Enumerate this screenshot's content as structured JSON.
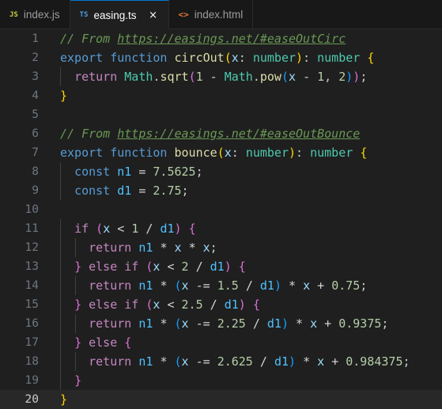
{
  "tabs": [
    {
      "icon": "JS",
      "label": "index.js",
      "active": false
    },
    {
      "icon": "TS",
      "label": "easing.ts",
      "active": true,
      "close": "×"
    },
    {
      "icon": "<>",
      "label": "index.html",
      "active": false
    }
  ],
  "colors": {
    "editor_bg": "#1f1f1f",
    "tabbar_bg": "#181818",
    "current_line_bg": "#282828",
    "comment": "#6a9955",
    "keyword": "#569cd6",
    "function": "#dcdcaa",
    "param": "#9cdcfe",
    "type": "#4ec9b0",
    "number": "#b5cea8"
  },
  "editor": {
    "current_line": 20,
    "lines": [
      {
        "n": "1",
        "tokens": [
          [
            "c-comment",
            "// From "
          ],
          [
            "c-comment c-link",
            "https://easings.net/#easeOutCirc"
          ]
        ]
      },
      {
        "n": "2",
        "tokens": [
          [
            "c-kw",
            "export"
          ],
          [
            "c-pl",
            " "
          ],
          [
            "c-kw",
            "function"
          ],
          [
            "c-pl",
            " "
          ],
          [
            "c-fn",
            "circOut"
          ],
          [
            "c-brace",
            "("
          ],
          [
            "c-param",
            "x"
          ],
          [
            "c-pl",
            ": "
          ],
          [
            "c-type",
            "number"
          ],
          [
            "c-brace",
            ")"
          ],
          [
            "c-pl",
            ": "
          ],
          [
            "c-type",
            "number"
          ],
          [
            "c-pl",
            " "
          ],
          [
            "c-brace",
            "{"
          ]
        ]
      },
      {
        "n": "3",
        "tokens": [
          [
            "c-pl",
            "  "
          ],
          [
            "c-ctrl",
            "return"
          ],
          [
            "c-pl",
            " "
          ],
          [
            "c-type",
            "Math"
          ],
          [
            "c-pl",
            "."
          ],
          [
            "c-fn",
            "sqrt"
          ],
          [
            "c-brace2",
            "("
          ],
          [
            "c-num",
            "1"
          ],
          [
            "c-pl",
            " "
          ],
          [
            "c-op",
            "-"
          ],
          [
            "c-pl",
            " "
          ],
          [
            "c-type",
            "Math"
          ],
          [
            "c-pl",
            "."
          ],
          [
            "c-fn",
            "pow"
          ],
          [
            "c-brace3",
            "("
          ],
          [
            "c-param",
            "x"
          ],
          [
            "c-pl",
            " "
          ],
          [
            "c-op",
            "-"
          ],
          [
            "c-pl",
            " "
          ],
          [
            "c-num",
            "1"
          ],
          [
            "c-pl",
            ", "
          ],
          [
            "c-num",
            "2"
          ],
          [
            "c-brace3",
            ")"
          ],
          [
            "c-brace2",
            ")"
          ],
          [
            "c-pl",
            ";"
          ]
        ]
      },
      {
        "n": "4",
        "tokens": [
          [
            "c-brace",
            "}"
          ]
        ]
      },
      {
        "n": "5",
        "tokens": []
      },
      {
        "n": "6",
        "tokens": [
          [
            "c-comment",
            "// From "
          ],
          [
            "c-comment c-link",
            "https://easings.net/#easeOutBounce"
          ]
        ]
      },
      {
        "n": "7",
        "tokens": [
          [
            "c-kw",
            "export"
          ],
          [
            "c-pl",
            " "
          ],
          [
            "c-kw",
            "function"
          ],
          [
            "c-pl",
            " "
          ],
          [
            "c-fn",
            "bounce"
          ],
          [
            "c-brace",
            "("
          ],
          [
            "c-param",
            "x"
          ],
          [
            "c-pl",
            ": "
          ],
          [
            "c-type",
            "number"
          ],
          [
            "c-brace",
            ")"
          ],
          [
            "c-pl",
            ": "
          ],
          [
            "c-type",
            "number"
          ],
          [
            "c-pl",
            " "
          ],
          [
            "c-brace",
            "{"
          ]
        ]
      },
      {
        "n": "8",
        "tokens": [
          [
            "c-pl",
            "  "
          ],
          [
            "c-kw",
            "const"
          ],
          [
            "c-pl",
            " "
          ],
          [
            "c-const",
            "n1"
          ],
          [
            "c-pl",
            " "
          ],
          [
            "c-op",
            "="
          ],
          [
            "c-pl",
            " "
          ],
          [
            "c-num",
            "7.5625"
          ],
          [
            "c-pl",
            ";"
          ]
        ]
      },
      {
        "n": "9",
        "tokens": [
          [
            "c-pl",
            "  "
          ],
          [
            "c-kw",
            "const"
          ],
          [
            "c-pl",
            " "
          ],
          [
            "c-const",
            "d1"
          ],
          [
            "c-pl",
            " "
          ],
          [
            "c-op",
            "="
          ],
          [
            "c-pl",
            " "
          ],
          [
            "c-num",
            "2.75"
          ],
          [
            "c-pl",
            ";"
          ]
        ]
      },
      {
        "n": "10",
        "tokens": []
      },
      {
        "n": "11",
        "tokens": [
          [
            "c-pl",
            "  "
          ],
          [
            "c-ctrl",
            "if"
          ],
          [
            "c-pl",
            " "
          ],
          [
            "c-brace2",
            "("
          ],
          [
            "c-param",
            "x"
          ],
          [
            "c-pl",
            " "
          ],
          [
            "c-op",
            "<"
          ],
          [
            "c-pl",
            " "
          ],
          [
            "c-num",
            "1"
          ],
          [
            "c-pl",
            " "
          ],
          [
            "c-op",
            "/"
          ],
          [
            "c-pl",
            " "
          ],
          [
            "c-const",
            "d1"
          ],
          [
            "c-brace2",
            ")"
          ],
          [
            "c-pl",
            " "
          ],
          [
            "c-brace2",
            "{"
          ]
        ]
      },
      {
        "n": "12",
        "tokens": [
          [
            "c-pl",
            "    "
          ],
          [
            "c-ctrl",
            "return"
          ],
          [
            "c-pl",
            " "
          ],
          [
            "c-const",
            "n1"
          ],
          [
            "c-pl",
            " "
          ],
          [
            "c-op",
            "*"
          ],
          [
            "c-pl",
            " "
          ],
          [
            "c-param",
            "x"
          ],
          [
            "c-pl",
            " "
          ],
          [
            "c-op",
            "*"
          ],
          [
            "c-pl",
            " "
          ],
          [
            "c-param",
            "x"
          ],
          [
            "c-pl",
            ";"
          ]
        ]
      },
      {
        "n": "13",
        "tokens": [
          [
            "c-pl",
            "  "
          ],
          [
            "c-brace2",
            "}"
          ],
          [
            "c-pl",
            " "
          ],
          [
            "c-ctrl",
            "else"
          ],
          [
            "c-pl",
            " "
          ],
          [
            "c-ctrl",
            "if"
          ],
          [
            "c-pl",
            " "
          ],
          [
            "c-brace2",
            "("
          ],
          [
            "c-param",
            "x"
          ],
          [
            "c-pl",
            " "
          ],
          [
            "c-op",
            "<"
          ],
          [
            "c-pl",
            " "
          ],
          [
            "c-num",
            "2"
          ],
          [
            "c-pl",
            " "
          ],
          [
            "c-op",
            "/"
          ],
          [
            "c-pl",
            " "
          ],
          [
            "c-const",
            "d1"
          ],
          [
            "c-brace2",
            ")"
          ],
          [
            "c-pl",
            " "
          ],
          [
            "c-brace2",
            "{"
          ]
        ]
      },
      {
        "n": "14",
        "tokens": [
          [
            "c-pl",
            "    "
          ],
          [
            "c-ctrl",
            "return"
          ],
          [
            "c-pl",
            " "
          ],
          [
            "c-const",
            "n1"
          ],
          [
            "c-pl",
            " "
          ],
          [
            "c-op",
            "*"
          ],
          [
            "c-pl",
            " "
          ],
          [
            "c-brace3",
            "("
          ],
          [
            "c-param",
            "x"
          ],
          [
            "c-pl",
            " "
          ],
          [
            "c-op",
            "-="
          ],
          [
            "c-pl",
            " "
          ],
          [
            "c-num",
            "1.5"
          ],
          [
            "c-pl",
            " "
          ],
          [
            "c-op",
            "/"
          ],
          [
            "c-pl",
            " "
          ],
          [
            "c-const",
            "d1"
          ],
          [
            "c-brace3",
            ")"
          ],
          [
            "c-pl",
            " "
          ],
          [
            "c-op",
            "*"
          ],
          [
            "c-pl",
            " "
          ],
          [
            "c-param",
            "x"
          ],
          [
            "c-pl",
            " "
          ],
          [
            "c-op",
            "+"
          ],
          [
            "c-pl",
            " "
          ],
          [
            "c-num",
            "0.75"
          ],
          [
            "c-pl",
            ";"
          ]
        ]
      },
      {
        "n": "15",
        "tokens": [
          [
            "c-pl",
            "  "
          ],
          [
            "c-brace2",
            "}"
          ],
          [
            "c-pl",
            " "
          ],
          [
            "c-ctrl",
            "else"
          ],
          [
            "c-pl",
            " "
          ],
          [
            "c-ctrl",
            "if"
          ],
          [
            "c-pl",
            " "
          ],
          [
            "c-brace2",
            "("
          ],
          [
            "c-param",
            "x"
          ],
          [
            "c-pl",
            " "
          ],
          [
            "c-op",
            "<"
          ],
          [
            "c-pl",
            " "
          ],
          [
            "c-num",
            "2.5"
          ],
          [
            "c-pl",
            " "
          ],
          [
            "c-op",
            "/"
          ],
          [
            "c-pl",
            " "
          ],
          [
            "c-const",
            "d1"
          ],
          [
            "c-brace2",
            ")"
          ],
          [
            "c-pl",
            " "
          ],
          [
            "c-brace2",
            "{"
          ]
        ]
      },
      {
        "n": "16",
        "tokens": [
          [
            "c-pl",
            "    "
          ],
          [
            "c-ctrl",
            "return"
          ],
          [
            "c-pl",
            " "
          ],
          [
            "c-const",
            "n1"
          ],
          [
            "c-pl",
            " "
          ],
          [
            "c-op",
            "*"
          ],
          [
            "c-pl",
            " "
          ],
          [
            "c-brace3",
            "("
          ],
          [
            "c-param",
            "x"
          ],
          [
            "c-pl",
            " "
          ],
          [
            "c-op",
            "-="
          ],
          [
            "c-pl",
            " "
          ],
          [
            "c-num",
            "2.25"
          ],
          [
            "c-pl",
            " "
          ],
          [
            "c-op",
            "/"
          ],
          [
            "c-pl",
            " "
          ],
          [
            "c-const",
            "d1"
          ],
          [
            "c-brace3",
            ")"
          ],
          [
            "c-pl",
            " "
          ],
          [
            "c-op",
            "*"
          ],
          [
            "c-pl",
            " "
          ],
          [
            "c-param",
            "x"
          ],
          [
            "c-pl",
            " "
          ],
          [
            "c-op",
            "+"
          ],
          [
            "c-pl",
            " "
          ],
          [
            "c-num",
            "0.9375"
          ],
          [
            "c-pl",
            ";"
          ]
        ]
      },
      {
        "n": "17",
        "tokens": [
          [
            "c-pl",
            "  "
          ],
          [
            "c-brace2",
            "}"
          ],
          [
            "c-pl",
            " "
          ],
          [
            "c-ctrl",
            "else"
          ],
          [
            "c-pl",
            " "
          ],
          [
            "c-brace2",
            "{"
          ]
        ]
      },
      {
        "n": "18",
        "tokens": [
          [
            "c-pl",
            "    "
          ],
          [
            "c-ctrl",
            "return"
          ],
          [
            "c-pl",
            " "
          ],
          [
            "c-const",
            "n1"
          ],
          [
            "c-pl",
            " "
          ],
          [
            "c-op",
            "*"
          ],
          [
            "c-pl",
            " "
          ],
          [
            "c-brace3",
            "("
          ],
          [
            "c-param",
            "x"
          ],
          [
            "c-pl",
            " "
          ],
          [
            "c-op",
            "-="
          ],
          [
            "c-pl",
            " "
          ],
          [
            "c-num",
            "2.625"
          ],
          [
            "c-pl",
            " "
          ],
          [
            "c-op",
            "/"
          ],
          [
            "c-pl",
            " "
          ],
          [
            "c-const",
            "d1"
          ],
          [
            "c-brace3",
            ")"
          ],
          [
            "c-pl",
            " "
          ],
          [
            "c-op",
            "*"
          ],
          [
            "c-pl",
            " "
          ],
          [
            "c-param",
            "x"
          ],
          [
            "c-pl",
            " "
          ],
          [
            "c-op",
            "+"
          ],
          [
            "c-pl",
            " "
          ],
          [
            "c-num",
            "0.984375"
          ],
          [
            "c-pl",
            ";"
          ]
        ]
      },
      {
        "n": "19",
        "tokens": [
          [
            "c-pl",
            "  "
          ],
          [
            "c-brace2",
            "}"
          ]
        ]
      },
      {
        "n": "20",
        "tokens": [
          [
            "c-brace",
            "}"
          ]
        ]
      }
    ]
  }
}
